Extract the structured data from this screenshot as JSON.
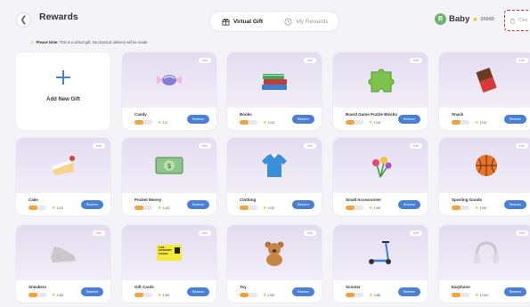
{
  "header": {
    "title": "Rewards",
    "tabs": [
      {
        "label": "Virtual Gift",
        "active": true
      },
      {
        "label": "My Rewards",
        "active": false
      }
    ],
    "user": {
      "initial": "B",
      "name": "Baby",
      "points": "99999"
    },
    "clear_label": "Clea"
  },
  "note": {
    "prefix": "Please Note:",
    "text": " This is a virtual gift. No physical delivery will be made."
  },
  "add_card": {
    "label": "Add New Gift"
  },
  "card_common": {
    "edit_label": "Edit",
    "redeem_label": "Redeem"
  },
  "cards": [
    {
      "name": "Candy",
      "price": "1/2",
      "progress": 0.5,
      "icon": "candy-icon"
    },
    {
      "name": "Books",
      "price": "1/10",
      "progress": 0.5,
      "icon": "books-icon"
    },
    {
      "name": "Board Game Puzzle Blocks",
      "price": "1/15",
      "progress": 0.5,
      "icon": "puzzle-icon"
    },
    {
      "name": "Snack",
      "price": "1/10",
      "progress": 0.5,
      "icon": "chocolate-icon"
    },
    {
      "name": "Cake",
      "price": "1/20",
      "progress": 0.5,
      "icon": "cake-icon"
    },
    {
      "name": "Pocket Money",
      "price": "1/20",
      "progress": 0.5,
      "icon": "money-icon"
    },
    {
      "name": "Clothing",
      "price": "1/30",
      "progress": 0.5,
      "icon": "shirt-icon"
    },
    {
      "name": "Small Accessories",
      "price": "1/30",
      "progress": 0.5,
      "icon": "flowers-icon"
    },
    {
      "name": "Sporting Goods",
      "price": "1/30",
      "progress": 0.5,
      "icon": "basketball-icon"
    },
    {
      "name": "Sneakers",
      "price": "1/50",
      "progress": 0.5,
      "icon": "sneaker-icon"
    },
    {
      "name": "Gift Cards",
      "price": "1/50",
      "progress": 0.5,
      "icon": "ticket-icon"
    },
    {
      "name": "Toy",
      "price": "1/50",
      "progress": 0.5,
      "icon": "teddy-bear-icon"
    },
    {
      "name": "Scooter",
      "price": "1/80",
      "progress": 0.5,
      "icon": "scooter-icon"
    },
    {
      "name": "Earphone",
      "price": "1/100",
      "progress": 0.5,
      "icon": "headphones-icon"
    }
  ],
  "ticket_art": {
    "line1": "LIVE",
    "line2": "CONCERT",
    "line3": "TICKET"
  },
  "colors": {
    "accent": "#4a7fd6",
    "progress": "#f4a236",
    "star": "#f5b50a",
    "highlight": "#e02828"
  }
}
